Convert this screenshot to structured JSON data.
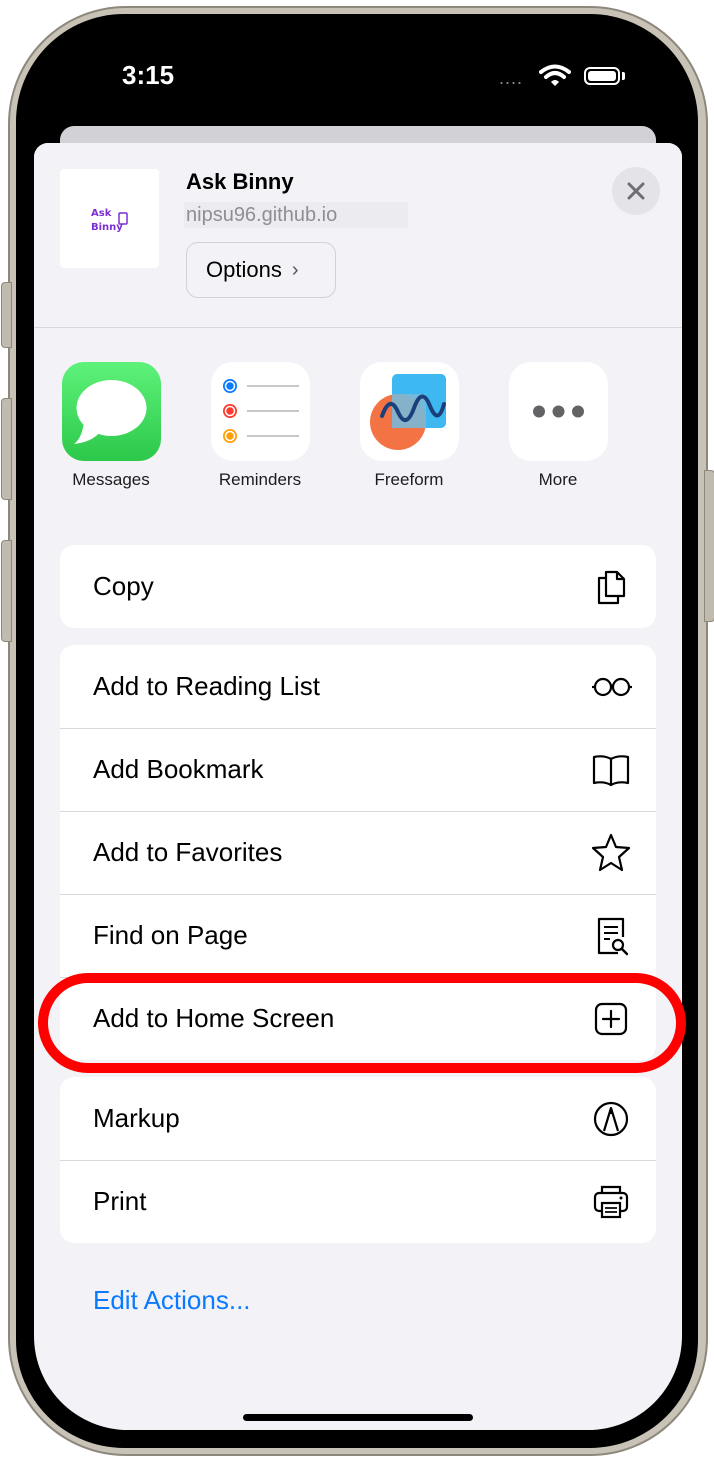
{
  "status_bar": {
    "time": "3:15",
    "dots": "....",
    "wifi_icon": "wifi-icon",
    "battery_icon": "battery-icon"
  },
  "share_sheet": {
    "title": "Ask Binny",
    "url": "nipsu96.github.io",
    "options_label": "Options",
    "close_icon": "close-icon",
    "thumbnail": {
      "logo_text": "Ask Binny",
      "logo_color": "#7b2fd4"
    }
  },
  "apps": [
    {
      "label": "Messages",
      "icon": "messages-icon",
      "color": "#34c759"
    },
    {
      "label": "Reminders",
      "icon": "reminders-icon",
      "color": "#ffffff"
    },
    {
      "label": "Freeform",
      "icon": "freeform-icon",
      "color": "#ffffff"
    },
    {
      "label": "More",
      "icon": "more-icon",
      "color": "#ffffff"
    }
  ],
  "groups": [
    [
      {
        "label": "Copy",
        "icon": "copy-icon"
      }
    ],
    [
      {
        "label": "Add to Reading List",
        "icon": "glasses-icon"
      },
      {
        "label": "Add Bookmark",
        "icon": "book-icon"
      },
      {
        "label": "Add to Favorites",
        "icon": "star-icon"
      },
      {
        "label": "Find on Page",
        "icon": "find-document-icon"
      },
      {
        "label": "Add to Home Screen",
        "icon": "plus-square-icon",
        "highlighted": true
      }
    ],
    [
      {
        "label": "Markup",
        "icon": "markup-icon"
      },
      {
        "label": "Print",
        "icon": "printer-icon"
      }
    ]
  ],
  "edit_actions_label": "Edit Actions...",
  "colors": {
    "accent": "#0a7aff",
    "highlight": "#ff0000",
    "sheet_bg": "#f2f2f7"
  }
}
